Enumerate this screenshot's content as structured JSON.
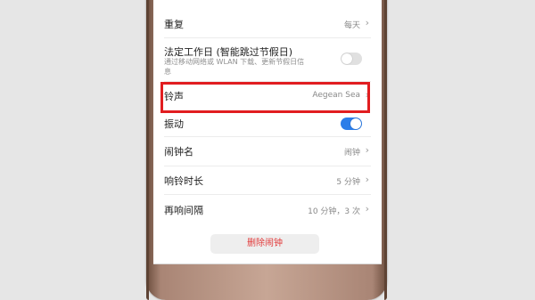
{
  "settings": {
    "repeat": {
      "label": "重复",
      "value": "每天"
    },
    "legal_workday": {
      "label": "法定工作日 (智能跳过节假日)",
      "subtitle_line1": "通过移动网络或 WLAN 下载、更新节假日信",
      "subtitle_line2": "息",
      "enabled": false
    },
    "ringtone": {
      "label": "铃声",
      "value": "Aegean Sea"
    },
    "vibrate": {
      "label": "振动",
      "enabled": true
    },
    "alarm_name": {
      "label": "闹钟名",
      "value": "闹钟"
    },
    "ring_duration": {
      "label": "响铃时长",
      "value": "5 分钟"
    },
    "snooze_interval": {
      "label": "再响间隔",
      "value": "10 分钟，3 次"
    }
  },
  "actions": {
    "delete_alarm": "删除闹钟"
  },
  "colors": {
    "toggle_on": "#2b7de9",
    "toggle_off": "#e0e0e0",
    "highlight": "#e11d20",
    "delete_text": "#e23a3a"
  }
}
